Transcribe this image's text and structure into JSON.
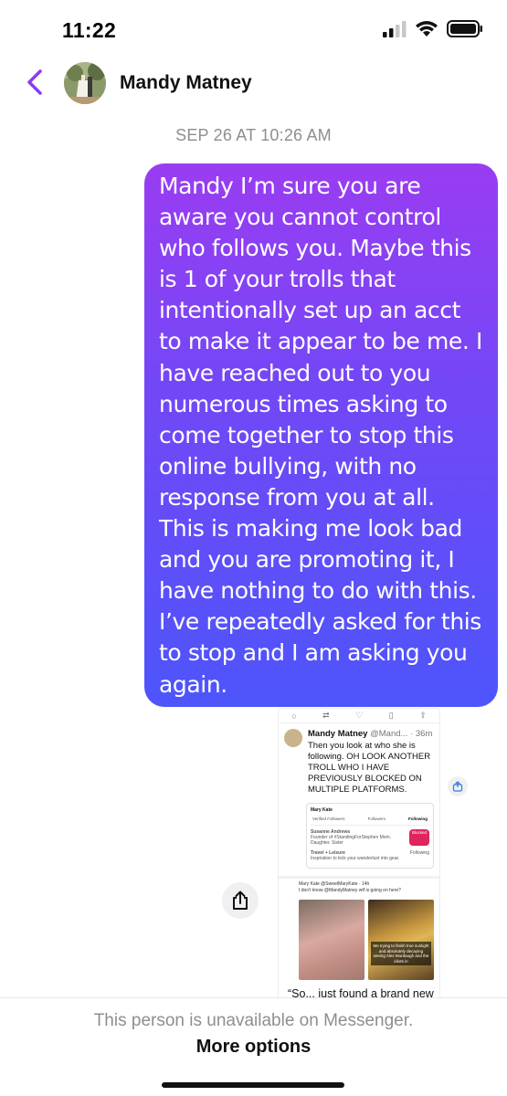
{
  "status_bar": {
    "time": "11:22"
  },
  "header": {
    "contact_name": "Mandy Matney"
  },
  "chat": {
    "timestamp": "SEP 26 AT 10:26 AM",
    "message": "Mandy I’m sure you are aware you cannot control who follows you. Maybe this is 1 of your trolls that intentionally set up an acct to make it appear to be me. I have reached out to you numerous times asking to come together to stop this online bullying, with no response from you at all. This is making me look bad and you are promoting it, I have nothing to do with this. I’ve repeatedly asked for this to stop and I am asking you again.",
    "shared_image": {
      "tweet1": {
        "name": "Mandy Matney",
        "handle": "@Mand... · 36m",
        "text": "Then you look at who she is following. OH LOOK ANOTHER TROLL WHO I HAVE PREVIOUSLY BLOCKED ON MULTIPLE PLATFORMS.",
        "embed_title": "Mary Kate",
        "embed_tabs": [
          "Verified Followers",
          "Followers",
          "Following"
        ],
        "embed_user1": "Susanne Andrews",
        "embed_user1_bio": "Founder of #StandingForStephen Mom. Daughter. Sister",
        "embed_badge": "Blocked",
        "embed_user2": "Travel + Leisure",
        "embed_user2_bio": "Inspiration to kick your wanderlust into gear.",
        "embed_follow": "Following"
      },
      "tweet2": {
        "header": "Mary Kate @SweetMaryKate · 14h",
        "text": "I don't know @MandyMatney wtf is going on here?",
        "image_caption": "Me trying to finish true sunlight and absolutely decaying seeing Alex Murdaugh and the idiots in",
        "quote": "“So... just found a brand new"
      }
    }
  },
  "footer": {
    "unavailable_text": "This person is unavailable on Messenger.",
    "more_options_label": "More options"
  }
}
